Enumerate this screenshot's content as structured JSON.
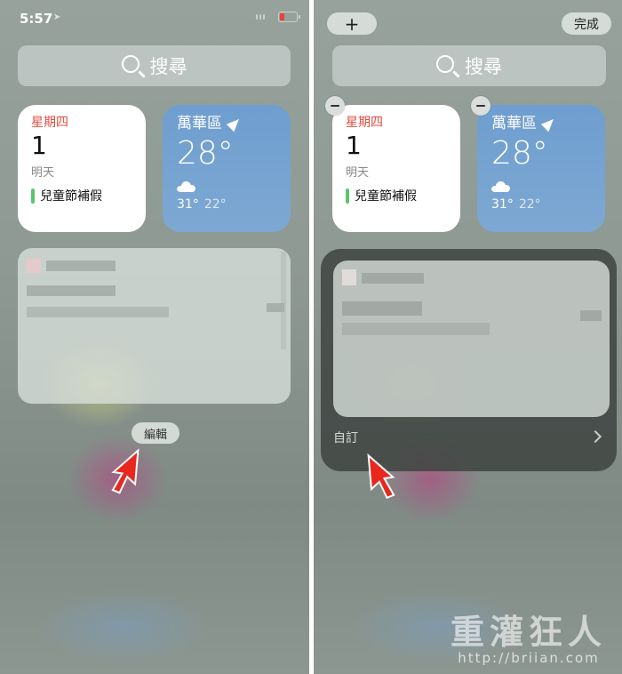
{
  "left": {
    "status_time": "5:57",
    "search_label": "搜尋",
    "calendar": {
      "weekday": "星期四",
      "date": "1",
      "tomorrow": "明天",
      "event": "兒童節補假"
    },
    "weather": {
      "city": "萬華區",
      "temp": "28°",
      "high": "31°",
      "low": "22°"
    },
    "edit_label": "編輯"
  },
  "right": {
    "add_label": "+",
    "done_label": "完成",
    "search_label": "搜尋",
    "calendar": {
      "weekday": "星期四",
      "date": "1",
      "tomorrow": "明天",
      "event": "兒童節補假"
    },
    "weather": {
      "city": "萬華區",
      "temp": "28°",
      "high": "31°",
      "low": "22°"
    },
    "customize_label": "自訂"
  },
  "watermark": {
    "title": "重灌狂人",
    "url": "http://briian.com"
  },
  "colors": {
    "weekday_red": "#e84b3f",
    "event_green": "#5fc36e",
    "weather_blue": "#6e9ecf",
    "cursor_red": "#e8281f"
  }
}
